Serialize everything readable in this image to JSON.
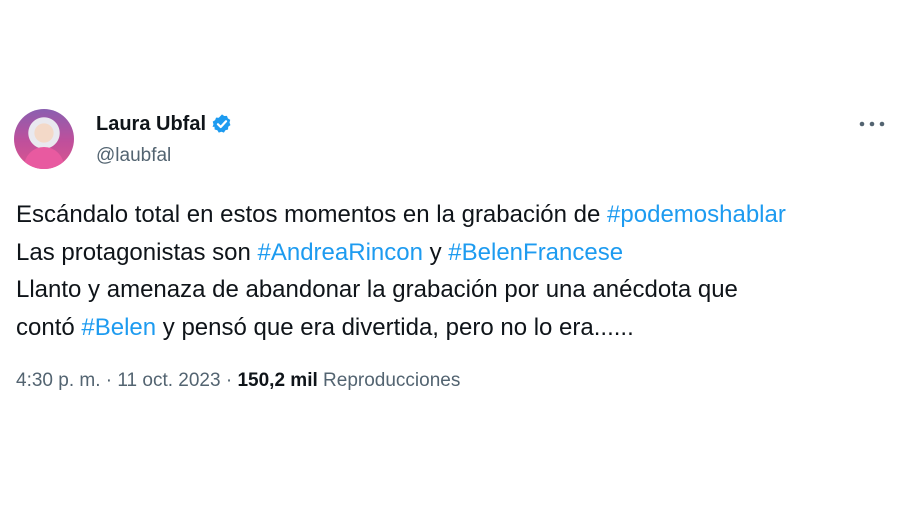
{
  "author": {
    "name": "Laura Ubfal",
    "handle": "@laubfal",
    "verified": true
  },
  "more_icon": "more-horizontal-icon",
  "colors": {
    "link": "#1d9bf0",
    "verified": "#1d9bf0",
    "secondary_text": "#536471"
  },
  "tweet": {
    "line1_text": "Escándalo total en estos momentos en la grabación de ",
    "line1_tag": "#podemoshablar",
    "line2_text": "Las protagonistas son ",
    "line2_tag1": "#AndreaRincon",
    "line2_mid": " y ",
    "line2_tag2": "#BelenFrancese",
    "line3_text": "Llanto y amenaza de abandonar la grabación por una anécdota que",
    "line4_pre": "contó ",
    "line4_tag": "#Belen",
    "line4_post": " y pensó que era divertida, pero no lo era......"
  },
  "meta": {
    "time": "4:30 p. m.",
    "sep1": " · ",
    "date": "11 oct. 2023",
    "sep2": " · ",
    "views": "150,2 mil",
    "views_label": " Reproducciones"
  }
}
